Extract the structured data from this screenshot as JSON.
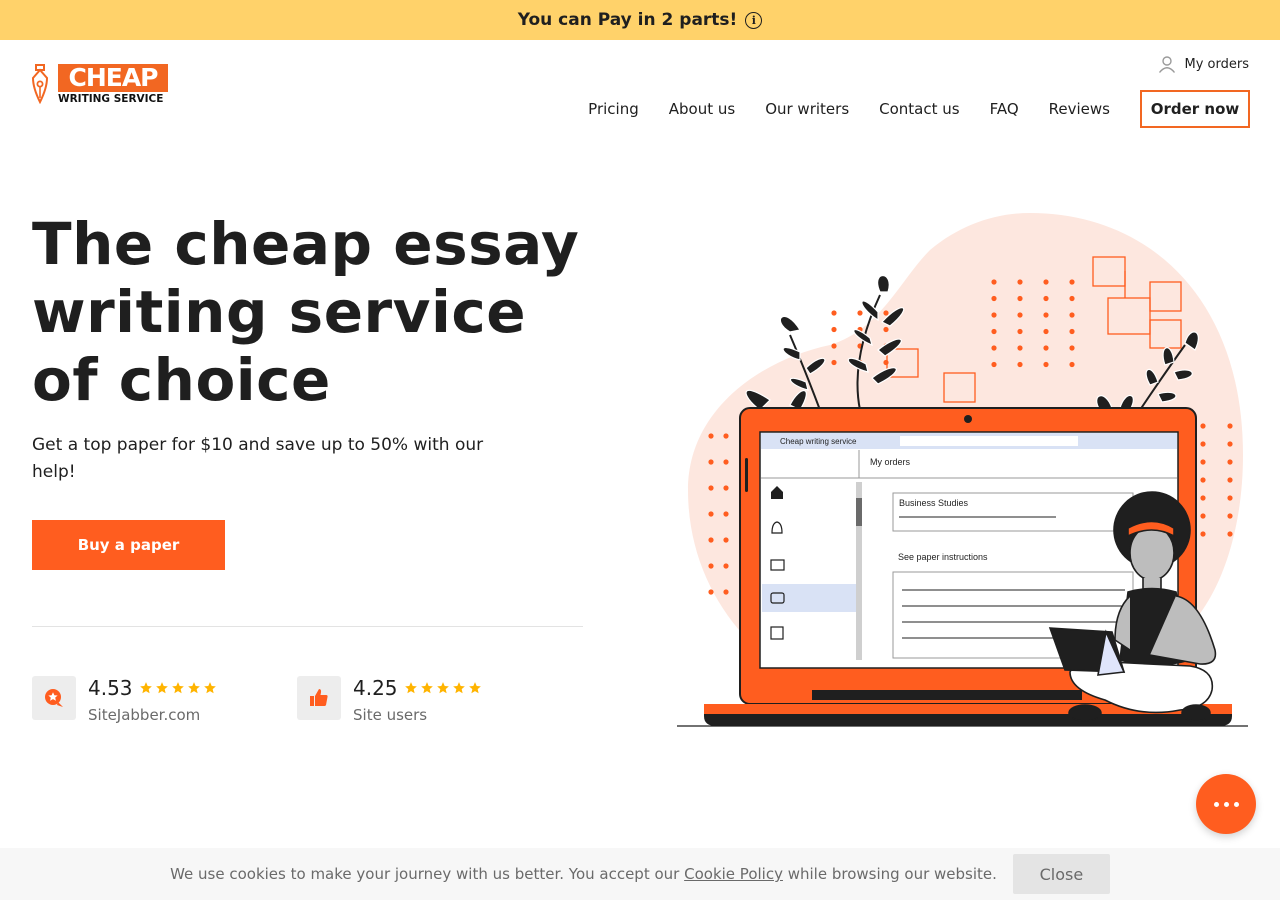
{
  "promo": {
    "text": "You can Pay in 2 parts!",
    "icon": "info-icon"
  },
  "logo": {
    "word": "CHEAP",
    "sub": "WRITING SERVICE",
    "icon": "pen-nib-icon",
    "color": "#f26722"
  },
  "header": {
    "my_orders": "My orders",
    "user_icon": "user-icon"
  },
  "nav": {
    "items": [
      "Pricing",
      "About us",
      "Our writers",
      "Contact us",
      "FAQ",
      "Reviews"
    ],
    "order_button": "Order now"
  },
  "hero": {
    "title": "The cheap essay writing service of choice",
    "subtitle": "Get a top paper for $10 and save up to 50% with our help!",
    "cta": "Buy a paper"
  },
  "ratings": [
    {
      "score": "4.53",
      "stars": 5,
      "source": "SiteJabber.com",
      "icon": "sitejabber-icon"
    },
    {
      "score": "4.25",
      "stars": 5,
      "source": "Site users",
      "icon": "thumbs-up-icon"
    }
  ],
  "illustration": {
    "app_title": "Cheap writing service",
    "page_title": "My orders",
    "field_label": "Business Studies",
    "instructions_label": "See paper instructions"
  },
  "cookie": {
    "text_before": "We use cookies to make your journey with us better. You accept our",
    "link": "Cookie Policy",
    "text_after": "while browsing our website.",
    "close": "Close"
  },
  "colors": {
    "accent": "#ff5d1f",
    "promo_bg": "#ffd26a",
    "star": "#ffb400",
    "blob": "#fde7df"
  }
}
